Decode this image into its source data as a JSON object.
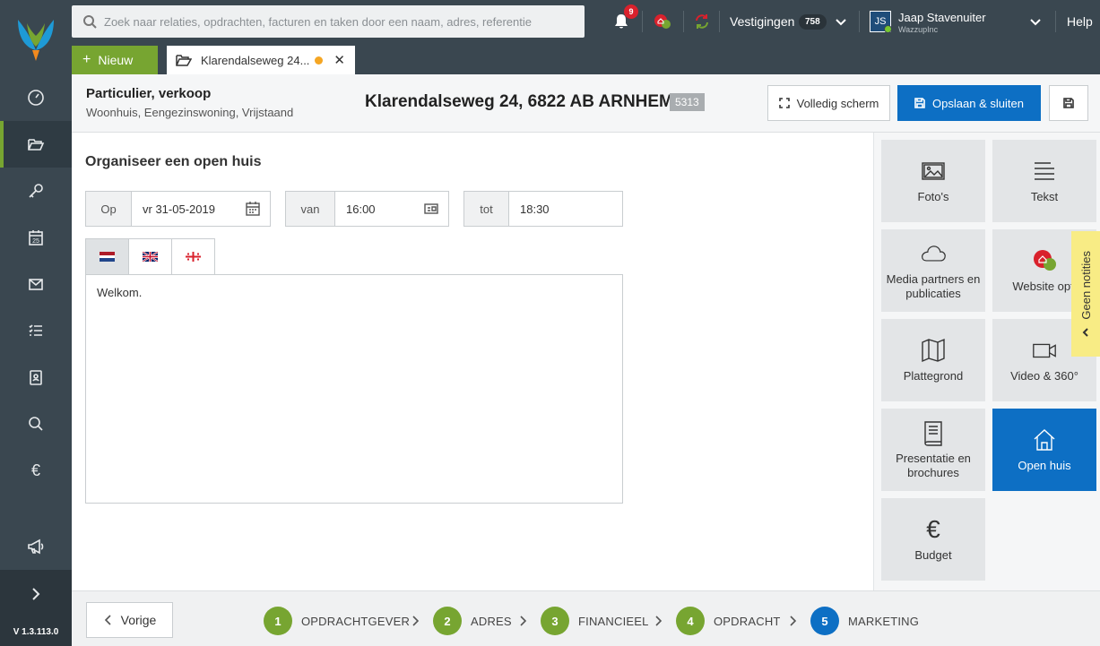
{
  "sidebar": {
    "version": "V 1.3.113.0",
    "items": [
      {
        "icon": "dashboard-icon"
      },
      {
        "icon": "folder-icon",
        "active": true
      },
      {
        "icon": "key-icon"
      },
      {
        "icon": "calendar-icon",
        "date": "25"
      },
      {
        "icon": "mail-icon"
      },
      {
        "icon": "tasks-icon"
      },
      {
        "icon": "contacts-icon"
      },
      {
        "icon": "search-icon"
      },
      {
        "icon": "euro-icon",
        "glyph": "€"
      }
    ]
  },
  "topbar": {
    "search_placeholder": "Zoek naar relaties, opdrachten, facturen en taken door een naam, adres, referentie",
    "notifications_count": "9",
    "vestigingen_label": "Vestigingen",
    "vestigingen_count": "758",
    "user_initials": "JS",
    "user_name": "Jaap Stavenuiter",
    "user_org": "WazzupInc",
    "help_label": "Help"
  },
  "tabbar": {
    "new_label": "Nieuw",
    "tab_label": "Klarendalseweg 24...",
    "tab_close": "✕"
  },
  "header": {
    "type": "Particulier, verkoop",
    "subtype": "Woonhuis, Eengezinswoning, Vrijstaand",
    "address": "Klarendalseweg 24, 6822 AB ARNHEM",
    "id": "5313",
    "fullscreen_label": "Volledig scherm",
    "save_close_label": "Opslaan & sluiten"
  },
  "main": {
    "title": "Organiseer een open huis",
    "date_label": "Op",
    "date_value": "vr 31-05-2019",
    "from_label": "van",
    "from_value": "16:00",
    "to_label": "tot",
    "to_value": "18:30",
    "languages": [
      "nl",
      "en",
      "other"
    ],
    "editor_text": "Welkom."
  },
  "tiles": [
    {
      "icon": "photos-icon",
      "label": "Foto's"
    },
    {
      "icon": "text-icon",
      "label": "Tekst"
    },
    {
      "icon": "cloud-icon",
      "label": "Media partners en publicaties"
    },
    {
      "icon": "website-icon",
      "label": "Website opti"
    },
    {
      "icon": "map-icon",
      "label": "Plattegrond"
    },
    {
      "icon": "video-icon",
      "label": "Video & 360°"
    },
    {
      "icon": "book-icon",
      "label": "Presentatie en brochures"
    },
    {
      "icon": "house-icon",
      "label": "Open huis",
      "active": true
    },
    {
      "icon": "euro-icon",
      "label": "Budget",
      "glyph": "€"
    }
  ],
  "notes_label": "Geen notities",
  "footer": {
    "prev_label": "Vorige",
    "steps": [
      {
        "num": "1",
        "label": "OPDRACHTGEVER"
      },
      {
        "num": "2",
        "label": "ADRES"
      },
      {
        "num": "3",
        "label": "FINANCIEEL"
      },
      {
        "num": "4",
        "label": "OPDRACHT"
      },
      {
        "num": "5",
        "label": "MARKETING",
        "current": true
      }
    ]
  },
  "colors": {
    "sidebar": "#3a4750",
    "accent_green": "#77a531",
    "accent_blue": "#0d6fc4",
    "notes_yellow": "#f8ec85"
  }
}
